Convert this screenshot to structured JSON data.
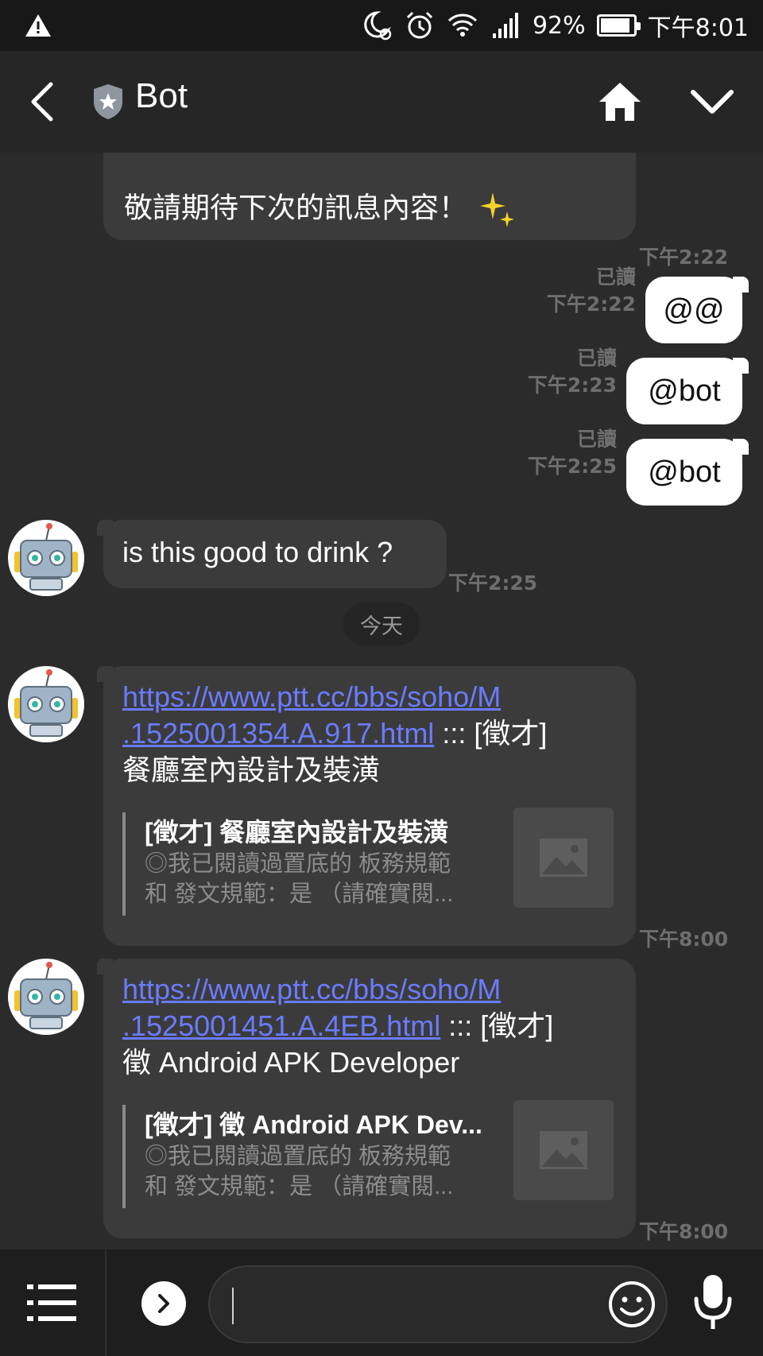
{
  "status_bar": {
    "battery_percent": "92%",
    "battery_level": 0.92,
    "time": "下午8:01"
  },
  "header": {
    "title": "Bot"
  },
  "messages": {
    "m1": {
      "text": "敬請期待下次的訊息內容！",
      "time": "下午2:22"
    },
    "m2": {
      "text": "@@",
      "read": "已讀",
      "time": "下午2:22"
    },
    "m3": {
      "text": "@bot",
      "read": "已讀",
      "time": "下午2:23"
    },
    "m4": {
      "text": "@bot",
      "read": "已讀",
      "time": "下午2:25"
    },
    "m5": {
      "text": "is this good to drink ?",
      "time": "下午2:25"
    },
    "date_divider": "今天",
    "m6": {
      "link_line1": "https://www.ptt.cc/bbs/soho/M",
      "link_line2": ".1525001354.A.917.html",
      "suffix": " ::: [徵才]",
      "line3": "餐廳室內設計及裝潢",
      "preview_title": "[徵才] 餐廳室內設計及裝潢",
      "preview_desc_1": "◎我已閱讀過置底的 板務規範",
      "preview_desc_2": "和 發文規範：是 （請確實閱...",
      "time": "下午8:00"
    },
    "m7": {
      "link_line1": "https://www.ptt.cc/bbs/soho/M",
      "link_line2": ".1525001451.A.4EB.html",
      "suffix": " ::: [徵才]",
      "line3": "徵 Android APK Developer",
      "preview_title": "[徵才] 徵 Android APK Dev...",
      "preview_desc_1": "◎我已閱讀過置底的 板務規範",
      "preview_desc_2": "和 發文規範：是 （請確實閱...",
      "time": "下午8:00"
    }
  },
  "input": {
    "value": ""
  },
  "colors": {
    "background": "#2b2b2b",
    "incoming_bubble": "#3b3b3b",
    "outgoing_bubble": "#ffffff",
    "link": "#6a7bff",
    "meta_text": "#6e6e6e"
  }
}
